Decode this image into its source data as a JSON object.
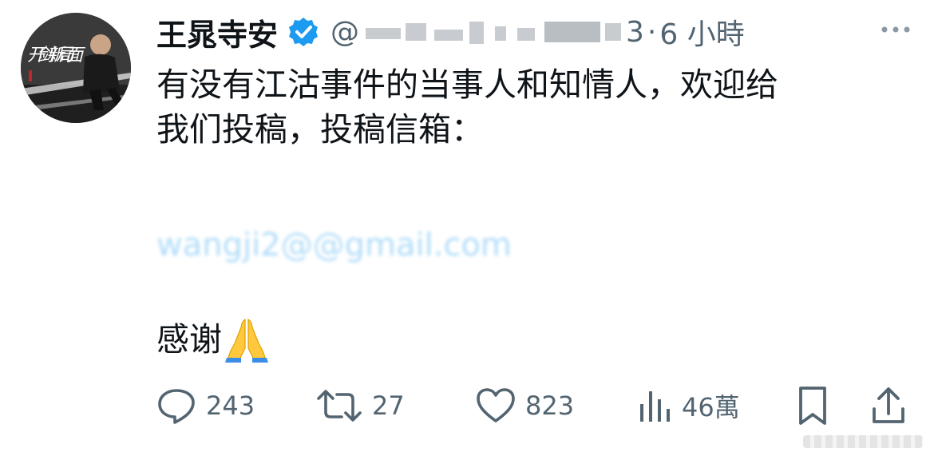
{
  "author": {
    "name": "王晁寺安",
    "handle_prefix": "@",
    "handle_suffix": "3",
    "time_sep": "·",
    "time": "6 小時",
    "avatar_caption": "开剑新局面"
  },
  "tweet": {
    "line1": "有没有江沽事件的当事人和知情人，欢迎给",
    "line2": "我们投稿，投稿信箱：",
    "email": "wangji2@@gmail.com",
    "thanks": "感谢"
  },
  "actions": {
    "reply_count": "243",
    "retweet_count": "27",
    "like_count": "823",
    "views_count": "46萬"
  },
  "colors": {
    "verified": "#1d9bf0",
    "icon": "#536471",
    "email_blur": "#1d9bf0"
  },
  "icons": [
    "verified-badge-icon",
    "more-icon",
    "reply-icon",
    "retweet-icon",
    "like-icon",
    "views-icon",
    "bookmark-icon",
    "share-icon",
    "pray-emoji-icon"
  ]
}
